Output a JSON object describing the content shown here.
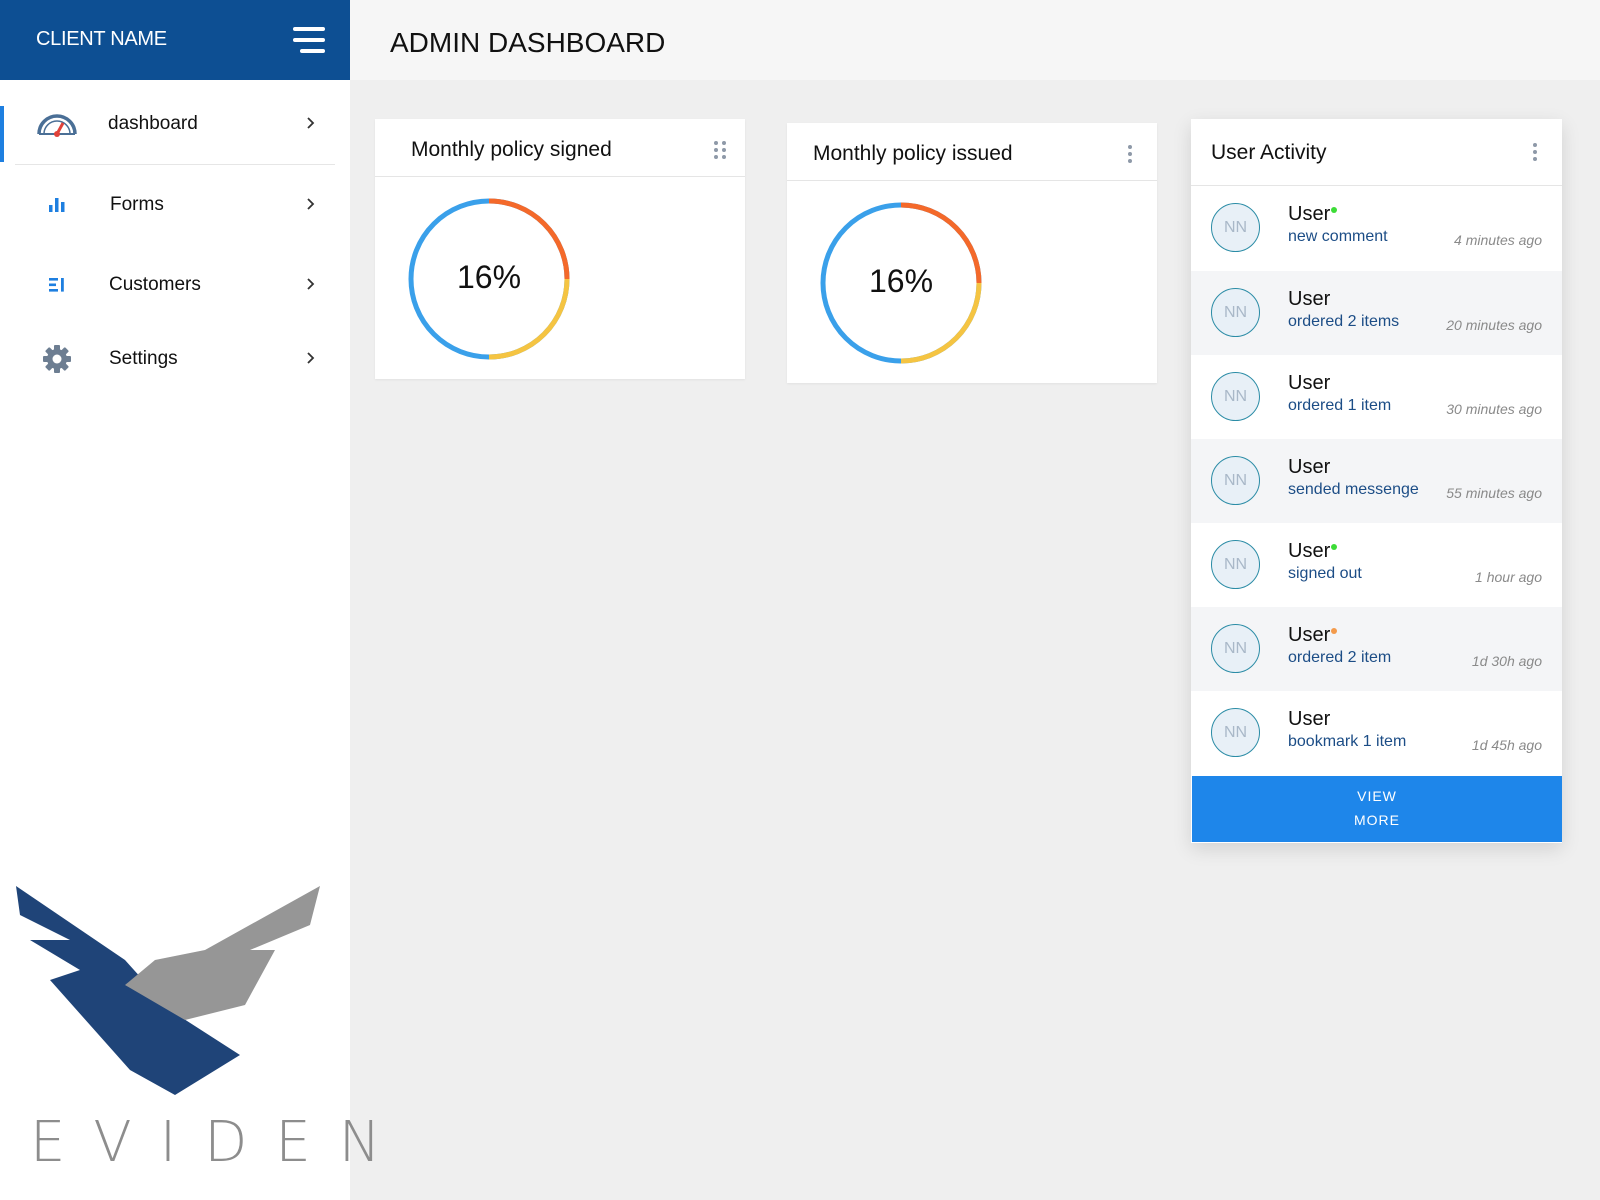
{
  "sidebar": {
    "client_name": "CLIENT NAME",
    "items": [
      {
        "label": "dashboard",
        "icon": "speedometer-icon",
        "active": true
      },
      {
        "label": "Forms",
        "icon": "bar-chart-icon",
        "active": false
      },
      {
        "label": "Customers",
        "icon": "list-icon",
        "active": false
      },
      {
        "label": "Settings",
        "icon": "gear-icon",
        "active": false
      }
    ],
    "logo_text": "EVIDEN"
  },
  "header": {
    "title": "ADMIN DASHBOARD"
  },
  "cards": [
    {
      "title": "Monthly policy signed",
      "value": "16%",
      "percent": 16
    },
    {
      "title": "Monthly policy issued",
      "value": "16%",
      "percent": 16
    }
  ],
  "activity": {
    "title": "User Activity",
    "items": [
      {
        "avatar": "NN",
        "name": "User",
        "status": "online",
        "desc": "new comment",
        "time": "4 minutes ago"
      },
      {
        "avatar": "NN",
        "name": "User",
        "status": "",
        "desc": "ordered 2 items",
        "time": "20 minutes ago"
      },
      {
        "avatar": "NN",
        "name": "User",
        "status": "",
        "desc": "ordered 1 item",
        "time": "30 minutes ago"
      },
      {
        "avatar": "NN",
        "name": "User",
        "status": "",
        "desc": "sended messenge",
        "time": "55 minutes ago"
      },
      {
        "avatar": "NN",
        "name": "User",
        "status": "online",
        "desc": "signed out",
        "time": "1 hour ago"
      },
      {
        "avatar": "NN",
        "name": "User",
        "status": "away",
        "desc": "ordered 2 item",
        "time": "1d 30h ago"
      },
      {
        "avatar": "NN",
        "name": "User",
        "status": "",
        "desc": "bookmark 1 item",
        "time": "1d 45h  ago"
      }
    ],
    "view_more_line1": "VIEW",
    "view_more_line2": "MORE"
  },
  "colors": {
    "brand": "#0d4f93",
    "accent": "#1e86ea",
    "donut_blue": "#3aa0ea",
    "donut_orange": "#f4692a",
    "donut_yellow": "#f5c442",
    "status_online": "#3ddc37",
    "status_away": "#f39a4b"
  }
}
